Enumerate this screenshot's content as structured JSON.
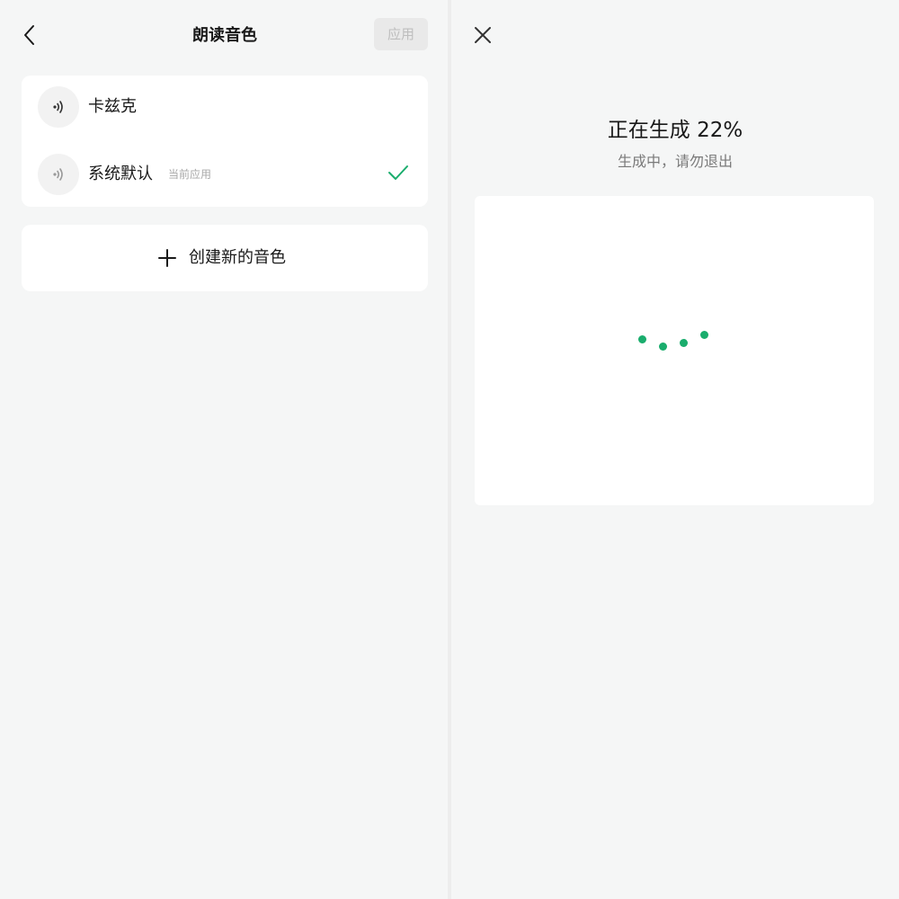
{
  "left_panel": {
    "header": {
      "title": "朗读音色",
      "apply_label": "应用"
    },
    "voices": [
      {
        "name": "卡兹克",
        "tag": "",
        "selected": false
      },
      {
        "name": "系统默认",
        "tag": "当前应用",
        "selected": true
      }
    ],
    "create_label": "创建新的音色"
  },
  "right_panel": {
    "title": "正在生成 22%",
    "subtitle": "生成中，请勿退出",
    "progress_percent": 22
  },
  "colors": {
    "accent": "#1aad6d",
    "panel_bg": "#f5f6f6",
    "card_bg": "#ffffff",
    "disabled_text": "#bebebe"
  },
  "icons": {
    "back": "chevron-left-icon",
    "voice": "sound-wave-icon",
    "check": "check-icon",
    "plus": "plus-icon",
    "close": "close-icon",
    "loading": "loading-dots-icon"
  }
}
